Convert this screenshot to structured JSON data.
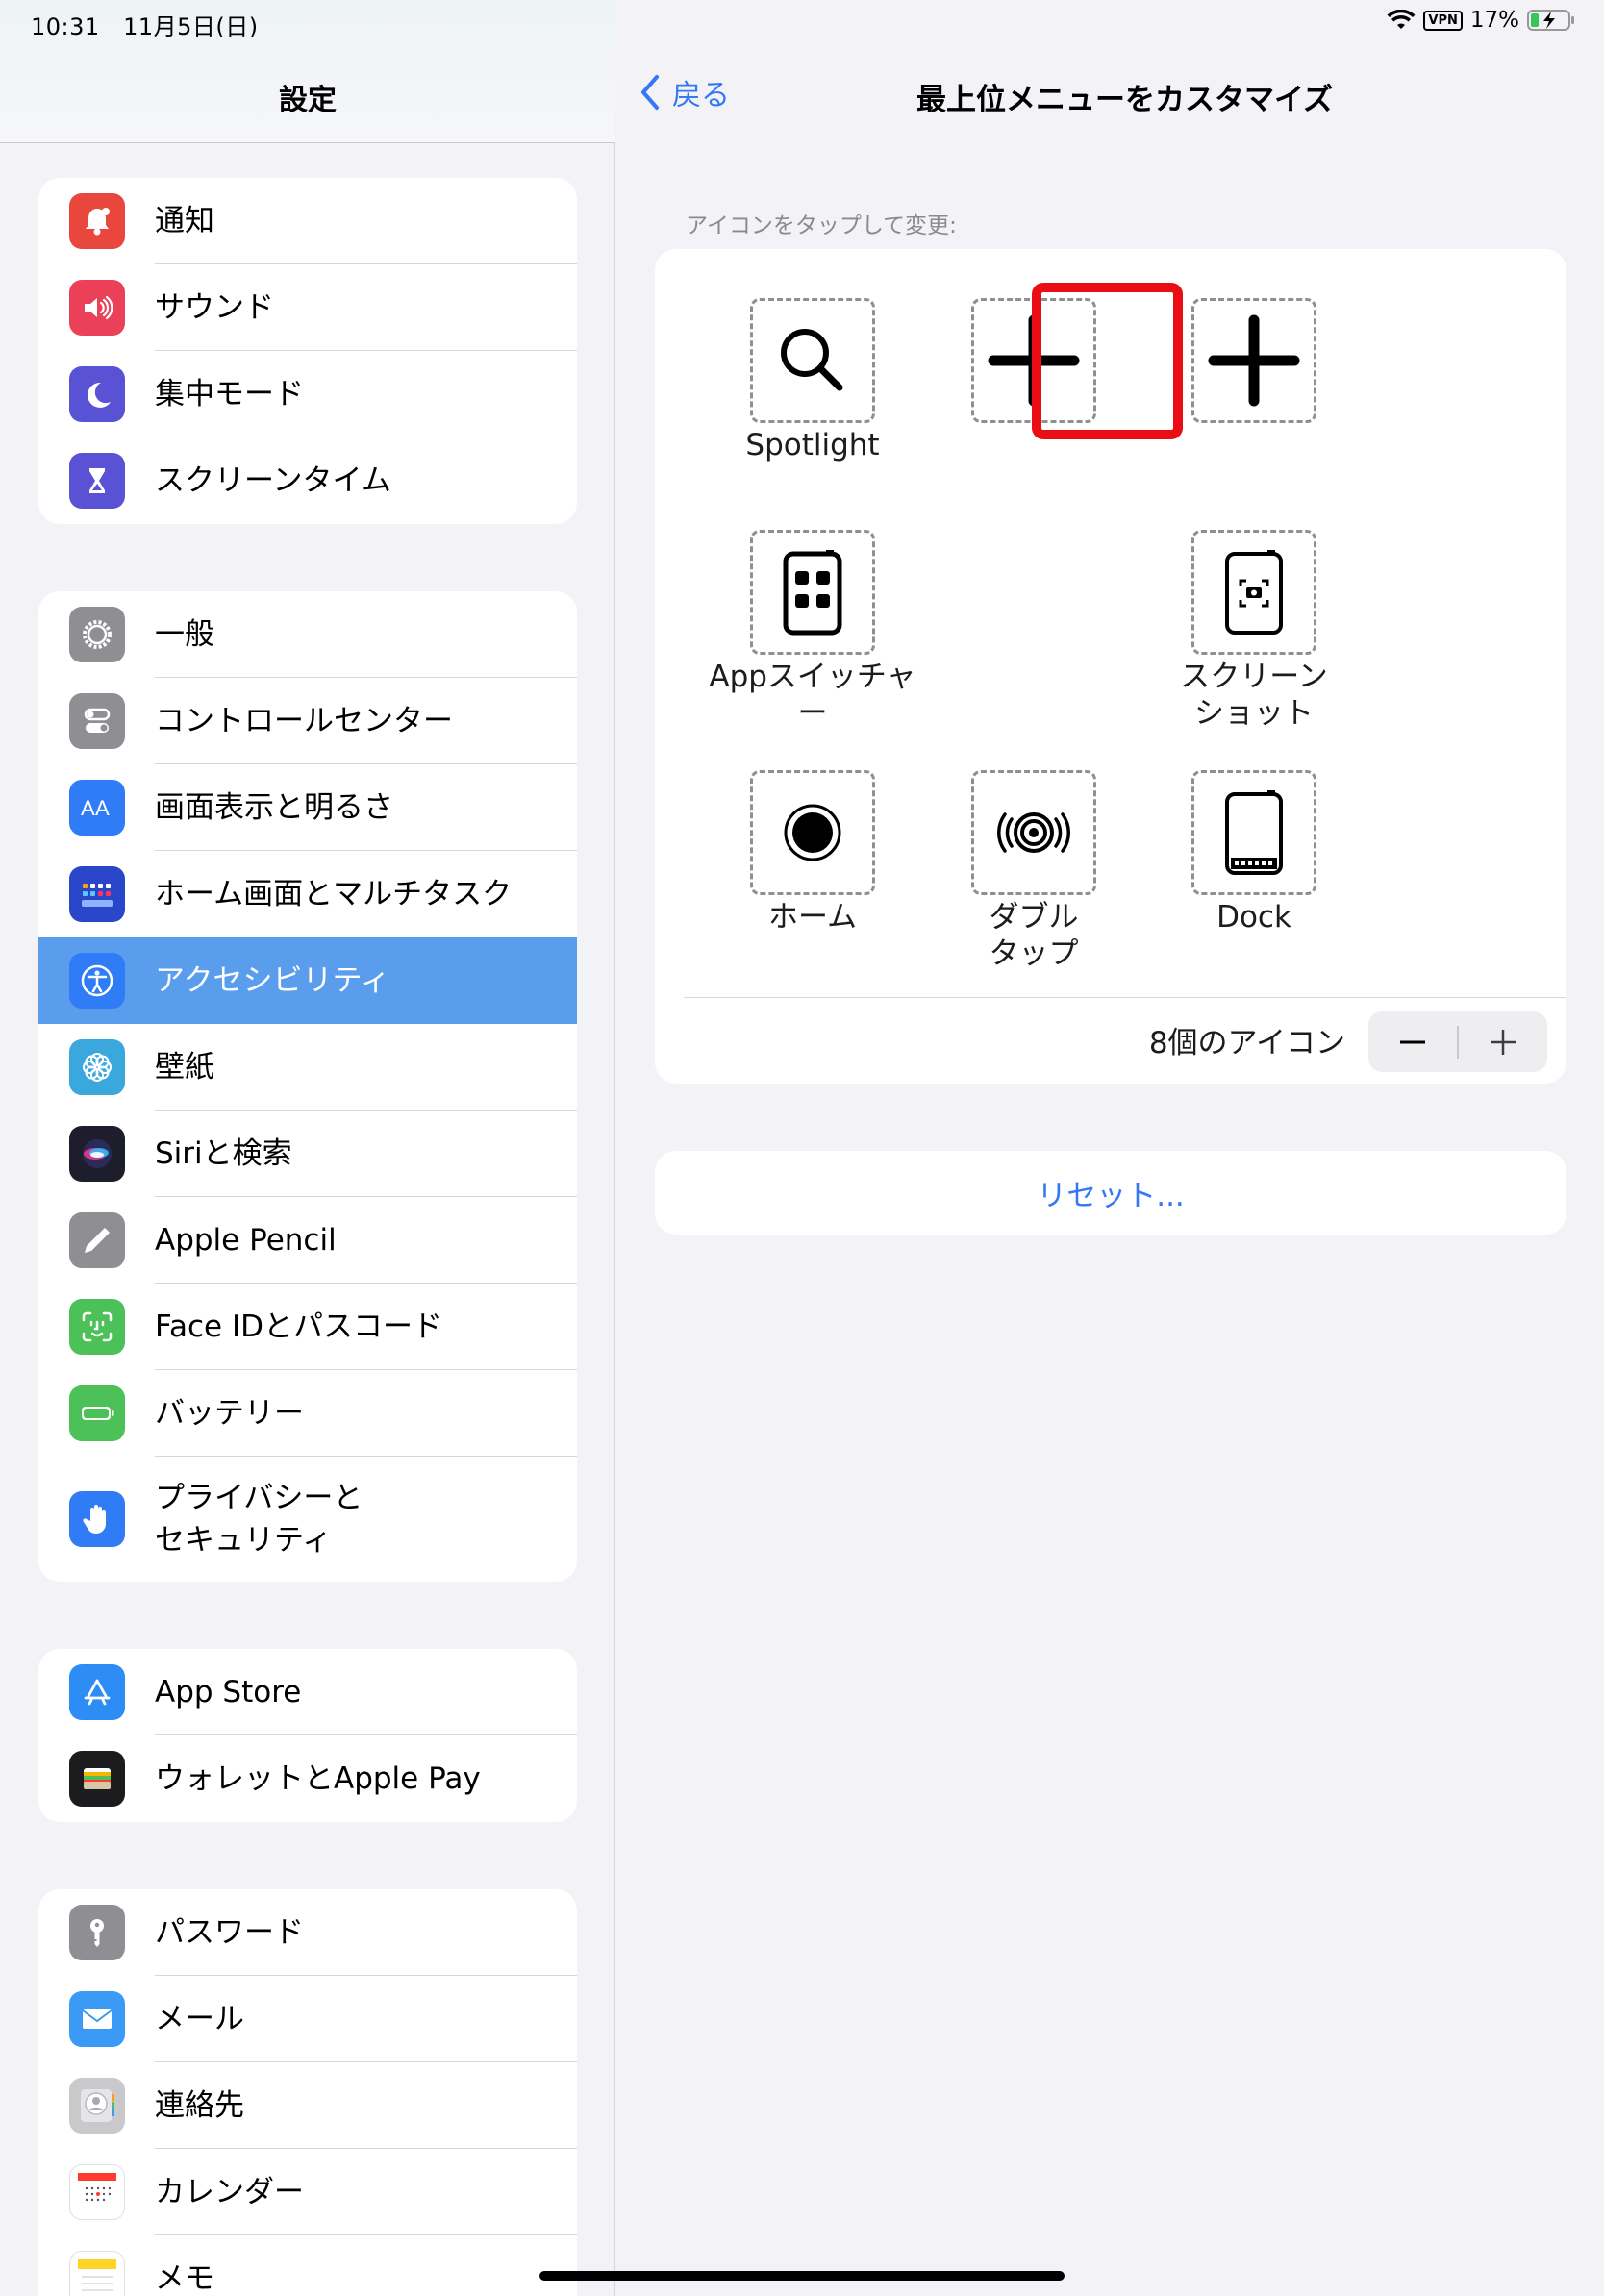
{
  "status_bar": {
    "time": "10:31",
    "date": "11月5日(日)",
    "vpn": "VPN",
    "battery": "17%"
  },
  "sidebar": {
    "title": "設定",
    "groups": [
      [
        {
          "label": "通知",
          "icon": "bell-icon",
          "color": "#e9473d"
        },
        {
          "label": "サウンド",
          "icon": "speaker-icon",
          "color": "#ea4158"
        },
        {
          "label": "集中モード",
          "icon": "moon-icon",
          "color": "#5a52d5"
        },
        {
          "label": "スクリーンタイム",
          "icon": "hourglass-icon",
          "color": "#5a52d5"
        }
      ],
      [
        {
          "label": "一般",
          "icon": "gear-icon",
          "color": "#8e8e93"
        },
        {
          "label": "コントロールセンター",
          "icon": "toggles-icon",
          "color": "#8e8e93"
        },
        {
          "label": "画面表示と明るさ",
          "icon": "text-size-icon",
          "color": "#2f7cf6"
        },
        {
          "label": "ホーム画面とマルチタスク",
          "icon": "home-grid-icon",
          "color": "#2b47c9"
        },
        {
          "label": "アクセシビリティ",
          "icon": "accessibility-icon",
          "color": "#2f7cf6",
          "selected": true
        },
        {
          "label": "壁紙",
          "icon": "flower-icon",
          "color": "#3aa8dd"
        },
        {
          "label": "Siriと検索",
          "icon": "siri-icon",
          "color": "#1d1d2c"
        },
        {
          "label": "Apple Pencil",
          "icon": "pencil-icon",
          "color": "#8e8e93"
        },
        {
          "label": "Face IDとパスコード",
          "icon": "face-id-icon",
          "color": "#4cc158"
        },
        {
          "label": "バッテリー",
          "icon": "battery-icon",
          "color": "#4cc158"
        },
        {
          "label": "プライバシーと\nセキュリティ",
          "icon": "hand-icon",
          "color": "#2f7cf6"
        }
      ],
      [
        {
          "label": "App Store",
          "icon": "app-store-icon",
          "color": "#2e8cf5"
        },
        {
          "label": "ウォレットとApple Pay",
          "icon": "wallet-icon",
          "color": "#1c1c1e"
        }
      ],
      [
        {
          "label": "パスワード",
          "icon": "key-icon",
          "color": "#8e8e93"
        },
        {
          "label": "メール",
          "icon": "mail-icon",
          "color": "#3a9af5"
        },
        {
          "label": "連絡先",
          "icon": "contacts-icon",
          "color": "#c9c9cc"
        },
        {
          "label": "カレンダー",
          "icon": "calendar-icon",
          "color": "#ffffff"
        },
        {
          "label": "メモ",
          "icon": "notes-icon",
          "color": "#ffffff"
        }
      ]
    ]
  },
  "detail": {
    "back_label": "戻る",
    "title": "最上位メニューをカスタマイズ",
    "hint": "アイコンをタップして変更:",
    "slots": [
      {
        "name": "spotlight",
        "caption": "Spotlight",
        "icon": "magnifier-icon"
      },
      {
        "name": "empty-2",
        "caption": "",
        "icon": "plus-icon",
        "highlighted": true
      },
      {
        "name": "empty-3",
        "caption": "",
        "icon": "plus-icon"
      },
      {
        "name": "app-switcher",
        "caption": "Appスイッチャー",
        "icon": "app-switcher-icon"
      },
      {
        "name": "screenshot",
        "caption": "スクリーン\nショット",
        "icon": "screenshot-icon"
      },
      {
        "name": "home",
        "caption": "ホーム",
        "icon": "home-button-icon"
      },
      {
        "name": "double-tap",
        "caption": "ダブル\nタップ",
        "icon": "double-tap-icon"
      },
      {
        "name": "dock",
        "caption": "Dock",
        "icon": "dock-icon"
      }
    ],
    "icon_count_label": "8個のアイコン",
    "decrement": "−",
    "increment": "+",
    "reset_label": "リセット..."
  },
  "colors": {
    "accent": "#3478f6",
    "selection": "#5a9ded",
    "highlight": "#ea0e14"
  }
}
